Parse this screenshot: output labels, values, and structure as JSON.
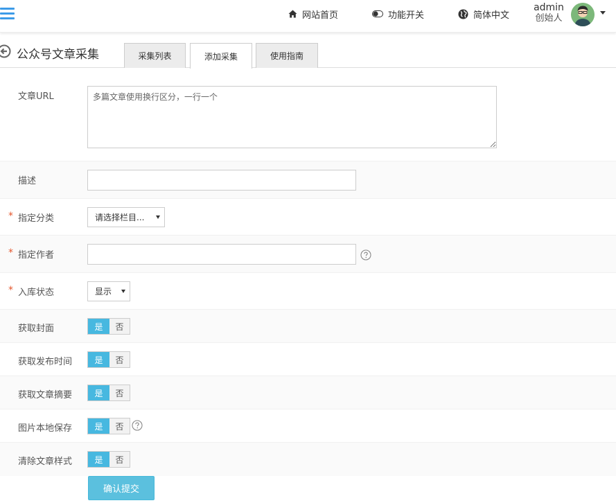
{
  "header": {
    "nav_home": "网站首页",
    "nav_func": "功能开关",
    "nav_lang": "简体中文",
    "user_name": "admin",
    "user_role": "创始人"
  },
  "page": {
    "title": "公众号文章采集",
    "tabs": [
      {
        "label": "采集列表",
        "active": false
      },
      {
        "label": "添加采集",
        "active": true
      },
      {
        "label": "使用指南",
        "active": false
      }
    ]
  },
  "form": {
    "url": {
      "label": "文章URL",
      "placeholder": "多篇文章使用换行区分，一行一个",
      "value": ""
    },
    "desc": {
      "label": "描述",
      "value": ""
    },
    "category": {
      "label": "指定分类",
      "selected": "请选择栏目...",
      "required": "*"
    },
    "author": {
      "label": "指定作者",
      "value": "",
      "required": "*"
    },
    "status": {
      "label": "入库状态",
      "selected": "显示",
      "required": "*"
    },
    "toggles": [
      {
        "label": "获取封面",
        "yes": "是",
        "no": "否",
        "value": "是"
      },
      {
        "label": "获取发布时间",
        "yes": "是",
        "no": "否",
        "value": "是"
      },
      {
        "label": "获取文章摘要",
        "yes": "是",
        "no": "否",
        "value": "是"
      },
      {
        "label": "图片本地保存",
        "yes": "是",
        "no": "否",
        "value": "是"
      },
      {
        "label": "清除文章样式",
        "yes": "是",
        "no": "否",
        "value": "是"
      }
    ],
    "submit": "确认提交"
  },
  "colors": {
    "accent": "#47b8e0",
    "submit": "#5bc0de",
    "required": "#e4572e",
    "menu": "#3c9be8"
  },
  "icons": {
    "menu": "hamburger-icon",
    "home": "home-icon",
    "toggle": "toggle-icon",
    "globe": "globe-icon",
    "back": "back-arrow-icon",
    "help": "question-circle-icon"
  }
}
